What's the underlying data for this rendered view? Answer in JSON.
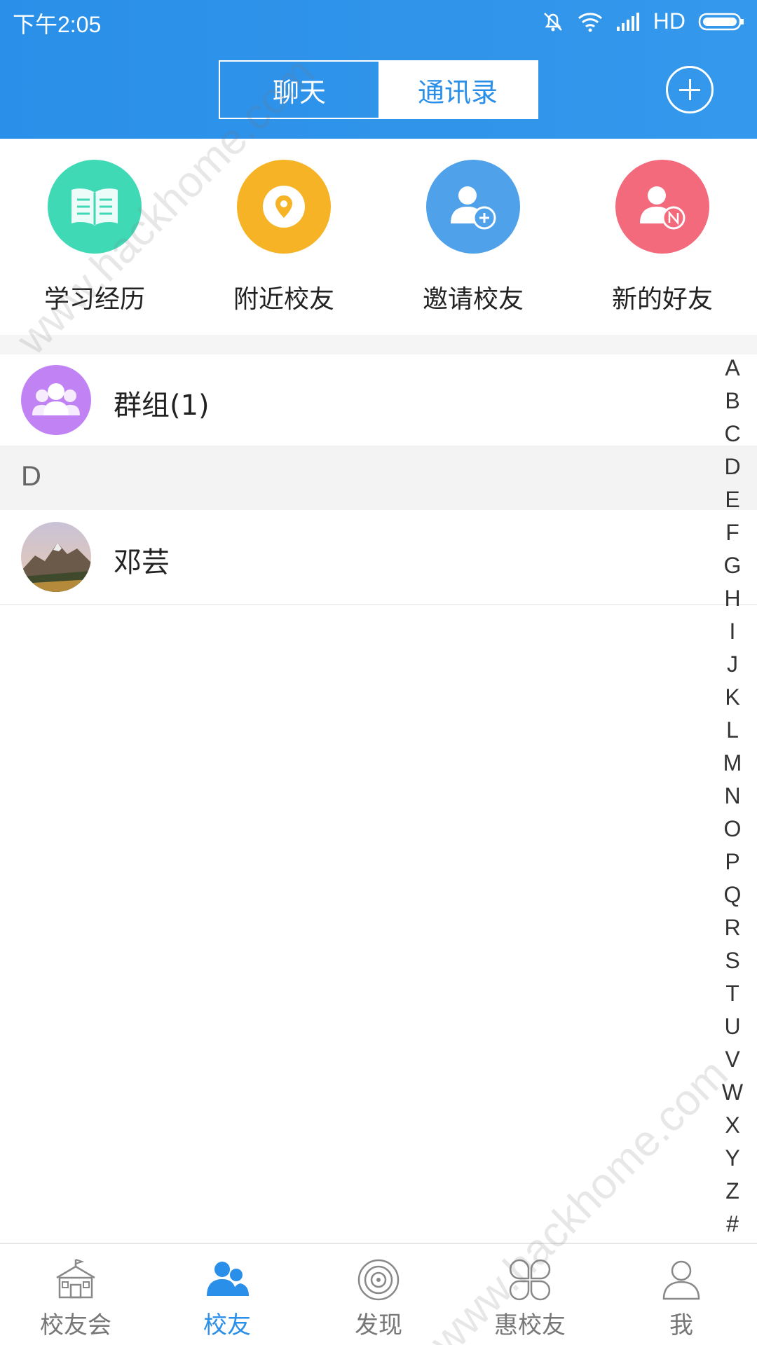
{
  "status_bar": {
    "time": "下午2:05",
    "network": "HD",
    "icons": [
      "mute-icon",
      "wifi-icon",
      "signal-icon",
      "battery-icon"
    ]
  },
  "header": {
    "tabs": [
      {
        "label": "聊天",
        "active": false
      },
      {
        "label": "通讯录",
        "active": true
      }
    ],
    "add_icon": "plus-circle-icon"
  },
  "quick_actions": [
    {
      "label": "学习经历",
      "icon": "book-icon",
      "color": "#3fd9b6"
    },
    {
      "label": "附近校友",
      "icon": "location-pin-icon",
      "color": "#f6b325"
    },
    {
      "label": "邀请校友",
      "icon": "add-user-icon",
      "color": "#4fa2ea"
    },
    {
      "label": "新的好友",
      "icon": "new-friend-icon",
      "color": "#f26a7c"
    }
  ],
  "groups": {
    "label": "群组(1)",
    "icon": "group-icon",
    "color": "#c183f4"
  },
  "sections": [
    {
      "letter": "D",
      "contacts": [
        {
          "name": "邓芸",
          "avatar": "mountain-landscape-avatar"
        }
      ]
    }
  ],
  "alphabet_index": [
    "A",
    "B",
    "C",
    "D",
    "E",
    "F",
    "G",
    "H",
    "I",
    "J",
    "K",
    "L",
    "M",
    "N",
    "O",
    "P",
    "Q",
    "R",
    "S",
    "T",
    "U",
    "V",
    "W",
    "X",
    "Y",
    "Z",
    "#"
  ],
  "bottom_tabs": [
    {
      "label": "校友会",
      "icon": "school-icon",
      "active": false
    },
    {
      "label": "校友",
      "icon": "alumni-icon",
      "active": true
    },
    {
      "label": "发现",
      "icon": "discover-icon",
      "active": false
    },
    {
      "label": "惠校友",
      "icon": "clover-icon",
      "active": false
    },
    {
      "label": "我",
      "icon": "profile-icon",
      "active": false
    }
  ],
  "watermark": "www.hackhome.com",
  "colors": {
    "primary": "#2a8fe8",
    "background_gray": "#f3f3f3"
  }
}
